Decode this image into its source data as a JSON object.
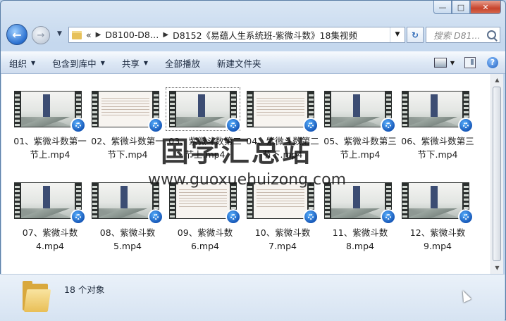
{
  "window": {
    "caption": {
      "minimize": "—",
      "maximize": "□",
      "close": "✕"
    }
  },
  "nav": {
    "back_icon": "back-arrow-icon",
    "forward_icon": "forward-arrow-icon",
    "breadcrumb": [
      "«",
      "D8100-D8…",
      "D8152《易蕴人生系统班-紫微斗数》18集视频"
    ],
    "search_placeholder": "搜索 D81..."
  },
  "toolbar": {
    "organize": "组织",
    "include_library": "包含到库中",
    "share": "共享",
    "play_all": "全部播放",
    "new_folder": "新建文件夹"
  },
  "files": [
    {
      "name": "01、紫微斗数第一节上.mp4",
      "thumb": "title"
    },
    {
      "name": "02、紫微斗数第一节下.mp4",
      "thumb": "doc"
    },
    {
      "name": "03、紫微斗数第二节上.mp4",
      "thumb": "title"
    },
    {
      "name": "04、紫微斗数第二节下.mp4",
      "thumb": "doc"
    },
    {
      "name": "05、紫微斗数第三节上.mp4",
      "thumb": "title"
    },
    {
      "name": "06、紫微斗数第三节下.mp4",
      "thumb": "title"
    },
    {
      "name": "07、紫微斗数4.mp4",
      "thumb": "title"
    },
    {
      "name": "08、紫微斗数5.mp4",
      "thumb": "title"
    },
    {
      "name": "09、紫微斗数6.mp4",
      "thumb": "doc"
    },
    {
      "name": "10、紫微斗数7.mp4",
      "thumb": "doc"
    },
    {
      "name": "11、紫微斗数8.mp4",
      "thumb": "title"
    },
    {
      "name": "12、紫微斗数9.mp4",
      "thumb": "title"
    }
  ],
  "watermark": {
    "title": "国学汇总站",
    "url": "www.guoxuehuizong.com"
  },
  "status": {
    "count": "18 个对象"
  }
}
